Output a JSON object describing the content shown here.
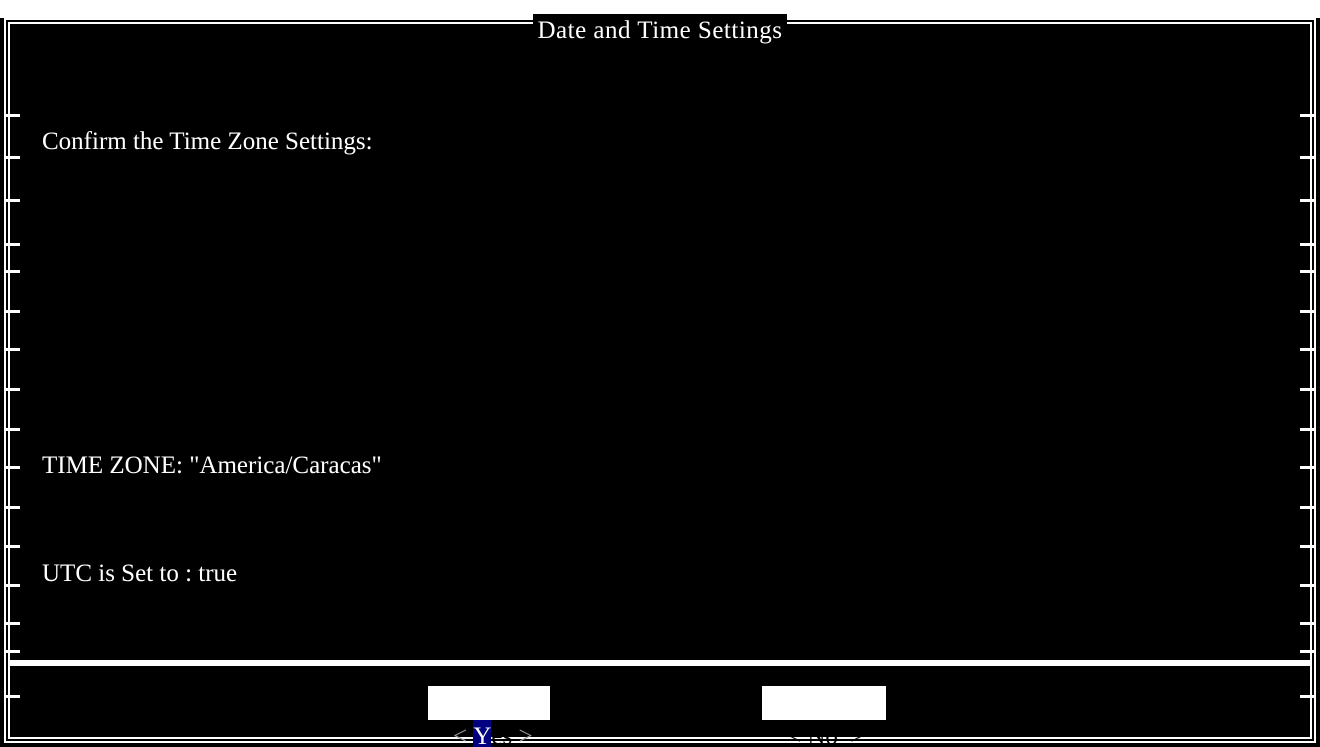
{
  "dialog": {
    "title": "Date and Time Settings",
    "heading": "Confirm the Time Zone Settings:",
    "lines": [
      "TIME ZONE: \"America/Caracas\"",
      "UTC is Set to : true"
    ]
  },
  "buttons": {
    "yes": {
      "open": "< ",
      "hotkey": "Y",
      "rest": "es",
      "close": " >"
    },
    "no": {
      "open": "< ",
      "hotkey": "N",
      "rest": "o",
      "close": "  >"
    }
  },
  "colors": {
    "background": "#000000",
    "foreground": "#ffffff",
    "hotkey_highlight": "#000080"
  }
}
